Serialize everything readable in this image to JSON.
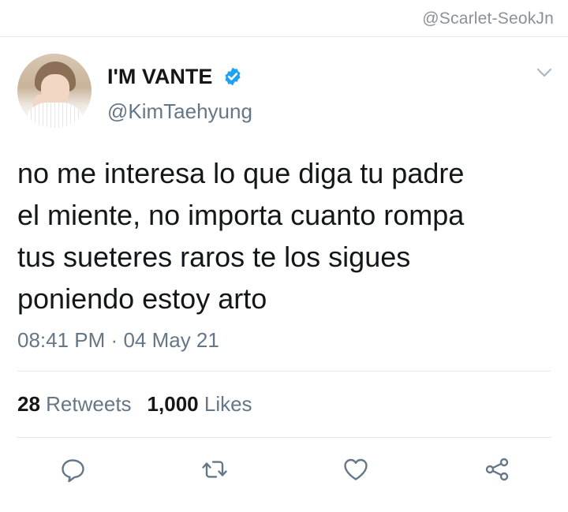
{
  "watermark": "@Scarlet-SeokJn",
  "tweet": {
    "display_name": "I'M VANTE",
    "handle": "@KimTaehyung",
    "verified": true,
    "text_lines": [
      "no me interesa lo que diga tu padre",
      "el miente, no importa cuanto rompa",
      "tus sueteres raros te los sigues",
      "poniendo estoy arto"
    ],
    "time": "08:41 PM",
    "separator": "·",
    "date": "04 May 21",
    "retweets_count": "28",
    "retweets_label": "Retweets",
    "likes_count": "1,000",
    "likes_label": "Likes"
  },
  "icons": {
    "verified": "verified-badge-icon",
    "menu": "chevron-down-icon",
    "reply": "reply-icon",
    "retweet": "retweet-icon",
    "like": "heart-icon",
    "share": "share-icon"
  },
  "colors": {
    "verified_blue": "#1da1f2",
    "secondary_text": "#657786",
    "primary_text": "#14171a",
    "divider": "#e1e8ed",
    "icon_gray": "#657786"
  }
}
